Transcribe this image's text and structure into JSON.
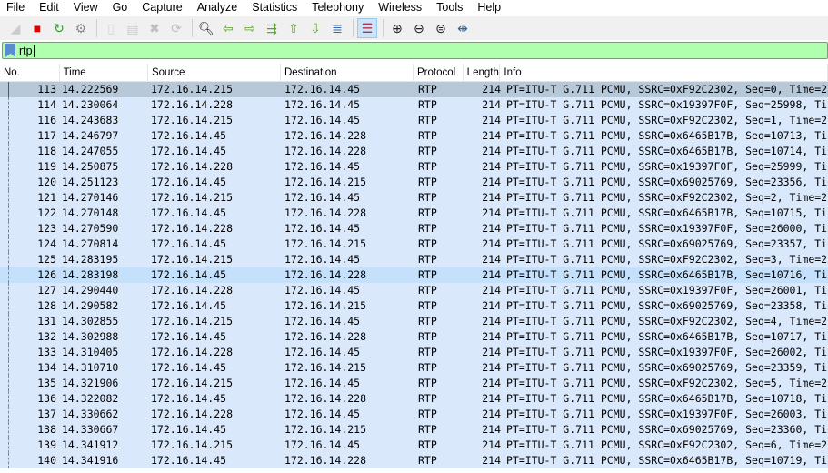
{
  "menu": [
    "File",
    "Edit",
    "View",
    "Go",
    "Capture",
    "Analyze",
    "Statistics",
    "Telephony",
    "Wireless",
    "Tools",
    "Help"
  ],
  "toolbar": [
    {
      "icon": "shark-fin-start-icon",
      "glyph": "◢",
      "color": "#888",
      "dim": true
    },
    {
      "icon": "stop-capture-icon",
      "glyph": "■",
      "color": "#e00000"
    },
    {
      "icon": "restart-capture-icon",
      "glyph": "↻",
      "color": "#2a9d2a"
    },
    {
      "icon": "capture-options-icon",
      "glyph": "⚙",
      "color": "#888"
    },
    {
      "sep": true
    },
    {
      "icon": "open-file-icon",
      "glyph": "▯",
      "color": "#aaa",
      "dim": true
    },
    {
      "icon": "save-file-icon",
      "glyph": "▤",
      "color": "#888",
      "dim": true
    },
    {
      "icon": "close-file-icon",
      "glyph": "✖",
      "color": "#666",
      "dim": true
    },
    {
      "icon": "reload-file-icon",
      "glyph": "⟳",
      "color": "#666",
      "dim": true
    },
    {
      "sep": true
    },
    {
      "icon": "find-packet-icon",
      "glyph": "🔍︎",
      "color": "#222"
    },
    {
      "icon": "go-back-icon",
      "glyph": "⇦",
      "color": "#5aa02c"
    },
    {
      "icon": "go-forward-icon",
      "glyph": "⇨",
      "color": "#5aa02c"
    },
    {
      "icon": "go-to-packet-icon",
      "glyph": "⇶",
      "color": "#5aa02c"
    },
    {
      "icon": "first-packet-icon",
      "glyph": "⇧",
      "color": "#5aa02c"
    },
    {
      "icon": "last-packet-icon",
      "glyph": "⇩",
      "color": "#5aa02c"
    },
    {
      "icon": "autoscroll-icon",
      "glyph": "≣",
      "color": "#3366aa"
    },
    {
      "sep": true
    },
    {
      "icon": "colorize-icon",
      "glyph": "☰",
      "color": "#b03050",
      "active": true
    },
    {
      "sep": true
    },
    {
      "icon": "zoom-in-icon",
      "glyph": "⊕",
      "color": "#222"
    },
    {
      "icon": "zoom-out-icon",
      "glyph": "⊖",
      "color": "#222"
    },
    {
      "icon": "zoom-normal-icon",
      "glyph": "⊜",
      "color": "#222"
    },
    {
      "icon": "resize-columns-icon",
      "glyph": "⇹",
      "color": "#3366aa"
    }
  ],
  "filter": {
    "value": "rtp"
  },
  "columns": [
    "No.",
    "Time",
    "Source",
    "Destination",
    "Protocol",
    "Length",
    "Info"
  ],
  "selected_row": "113",
  "hover_row": "126",
  "colors": {
    "row_bg": "#dae8fc",
    "selected_bg": "#b7c8d9",
    "filter_bg": "#afffaf"
  },
  "packets": [
    [
      "113",
      "14.222569",
      "172.16.14.215",
      "172.16.14.45",
      "RTP",
      "214",
      "PT=ITU-T G.711 PCMU, SSRC=0xF92C2302, Seq=0, Time=2"
    ],
    [
      "114",
      "14.230064",
      "172.16.14.228",
      "172.16.14.45",
      "RTP",
      "214",
      "PT=ITU-T G.711 PCMU, SSRC=0x19397F0F, Seq=25998, Ti"
    ],
    [
      "116",
      "14.243683",
      "172.16.14.215",
      "172.16.14.45",
      "RTP",
      "214",
      "PT=ITU-T G.711 PCMU, SSRC=0xF92C2302, Seq=1, Time=2"
    ],
    [
      "117",
      "14.246797",
      "172.16.14.45",
      "172.16.14.228",
      "RTP",
      "214",
      "PT=ITU-T G.711 PCMU, SSRC=0x6465B17B, Seq=10713, Ti"
    ],
    [
      "118",
      "14.247055",
      "172.16.14.45",
      "172.16.14.228",
      "RTP",
      "214",
      "PT=ITU-T G.711 PCMU, SSRC=0x6465B17B, Seq=10714, Ti"
    ],
    [
      "119",
      "14.250875",
      "172.16.14.228",
      "172.16.14.45",
      "RTP",
      "214",
      "PT=ITU-T G.711 PCMU, SSRC=0x19397F0F, Seq=25999, Ti"
    ],
    [
      "120",
      "14.251123",
      "172.16.14.45",
      "172.16.14.215",
      "RTP",
      "214",
      "PT=ITU-T G.711 PCMU, SSRC=0x69025769, Seq=23356, Ti"
    ],
    [
      "121",
      "14.270146",
      "172.16.14.215",
      "172.16.14.45",
      "RTP",
      "214",
      "PT=ITU-T G.711 PCMU, SSRC=0xF92C2302, Seq=2, Time=2"
    ],
    [
      "122",
      "14.270148",
      "172.16.14.45",
      "172.16.14.228",
      "RTP",
      "214",
      "PT=ITU-T G.711 PCMU, SSRC=0x6465B17B, Seq=10715, Ti"
    ],
    [
      "123",
      "14.270590",
      "172.16.14.228",
      "172.16.14.45",
      "RTP",
      "214",
      "PT=ITU-T G.711 PCMU, SSRC=0x19397F0F, Seq=26000, Ti"
    ],
    [
      "124",
      "14.270814",
      "172.16.14.45",
      "172.16.14.215",
      "RTP",
      "214",
      "PT=ITU-T G.711 PCMU, SSRC=0x69025769, Seq=23357, Ti"
    ],
    [
      "125",
      "14.283195",
      "172.16.14.215",
      "172.16.14.45",
      "RTP",
      "214",
      "PT=ITU-T G.711 PCMU, SSRC=0xF92C2302, Seq=3, Time=2"
    ],
    [
      "126",
      "14.283198",
      "172.16.14.45",
      "172.16.14.228",
      "RTP",
      "214",
      "PT=ITU-T G.711 PCMU, SSRC=0x6465B17B, Seq=10716, Ti"
    ],
    [
      "127",
      "14.290440",
      "172.16.14.228",
      "172.16.14.45",
      "RTP",
      "214",
      "PT=ITU-T G.711 PCMU, SSRC=0x19397F0F, Seq=26001, Ti"
    ],
    [
      "128",
      "14.290582",
      "172.16.14.45",
      "172.16.14.215",
      "RTP",
      "214",
      "PT=ITU-T G.711 PCMU, SSRC=0x69025769, Seq=23358, Ti"
    ],
    [
      "131",
      "14.302855",
      "172.16.14.215",
      "172.16.14.45",
      "RTP",
      "214",
      "PT=ITU-T G.711 PCMU, SSRC=0xF92C2302, Seq=4, Time=2"
    ],
    [
      "132",
      "14.302988",
      "172.16.14.45",
      "172.16.14.228",
      "RTP",
      "214",
      "PT=ITU-T G.711 PCMU, SSRC=0x6465B17B, Seq=10717, Ti"
    ],
    [
      "133",
      "14.310405",
      "172.16.14.228",
      "172.16.14.45",
      "RTP",
      "214",
      "PT=ITU-T G.711 PCMU, SSRC=0x19397F0F, Seq=26002, Ti"
    ],
    [
      "134",
      "14.310710",
      "172.16.14.45",
      "172.16.14.215",
      "RTP",
      "214",
      "PT=ITU-T G.711 PCMU, SSRC=0x69025769, Seq=23359, Ti"
    ],
    [
      "135",
      "14.321906",
      "172.16.14.215",
      "172.16.14.45",
      "RTP",
      "214",
      "PT=ITU-T G.711 PCMU, SSRC=0xF92C2302, Seq=5, Time=2"
    ],
    [
      "136",
      "14.322082",
      "172.16.14.45",
      "172.16.14.228",
      "RTP",
      "214",
      "PT=ITU-T G.711 PCMU, SSRC=0x6465B17B, Seq=10718, Ti"
    ],
    [
      "137",
      "14.330662",
      "172.16.14.228",
      "172.16.14.45",
      "RTP",
      "214",
      "PT=ITU-T G.711 PCMU, SSRC=0x19397F0F, Seq=26003, Ti"
    ],
    [
      "138",
      "14.330667",
      "172.16.14.45",
      "172.16.14.215",
      "RTP",
      "214",
      "PT=ITU-T G.711 PCMU, SSRC=0x69025769, Seq=23360, Ti"
    ],
    [
      "139",
      "14.341912",
      "172.16.14.215",
      "172.16.14.45",
      "RTP",
      "214",
      "PT=ITU-T G.711 PCMU, SSRC=0xF92C2302, Seq=6, Time=2"
    ],
    [
      "140",
      "14.341916",
      "172.16.14.45",
      "172.16.14.228",
      "RTP",
      "214",
      "PT=ITU-T G.711 PCMU, SSRC=0x6465B17B, Seq=10719, Ti"
    ]
  ]
}
